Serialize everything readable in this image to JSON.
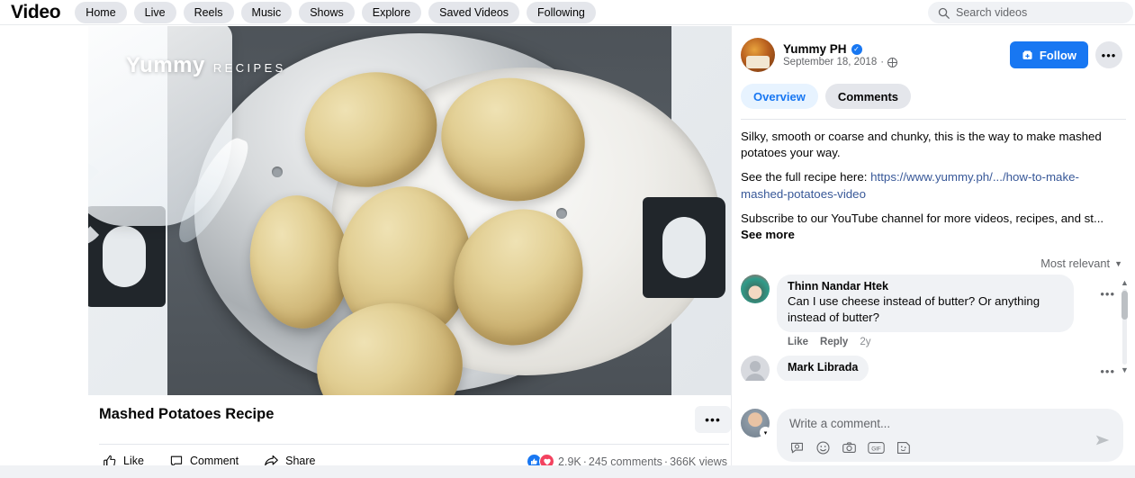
{
  "topbar": {
    "brand": "Video",
    "nav_items": [
      "Home",
      "Live",
      "Reels",
      "Music",
      "Shows",
      "Explore",
      "Saved Videos",
      "Following"
    ],
    "search_placeholder": "Search videos",
    "search_icon": "search-icon"
  },
  "video": {
    "watermark_main": "Yummy",
    "watermark_sub": "RECIPES",
    "title": "Mashed Potatoes Recipe",
    "more_label": "•••",
    "actions": [
      {
        "label": "Like",
        "icon": "thumbs-up-icon"
      },
      {
        "label": "Comment",
        "icon": "comment-bubble-icon"
      },
      {
        "label": "Share",
        "icon": "share-arrow-icon"
      }
    ],
    "reaction_like_icon": "like-reaction-icon",
    "reaction_love_icon": "love-reaction-icon",
    "reaction_count": "2.9K",
    "sep1": "·",
    "comment_count": "245 comments",
    "sep2": "·",
    "view_count": "366K views"
  },
  "side": {
    "poster_name": "Yummy PH",
    "verified_glyph": "✓",
    "posted_date": "September 18, 2018",
    "date_dot": "·",
    "privacy_icon": "globe-icon",
    "follow_label": "Follow",
    "follow_icon": "follow-plus-icon",
    "more_label": "•••",
    "tabs": [
      {
        "label": "Overview",
        "active": true
      },
      {
        "label": "Comments",
        "active": false
      }
    ],
    "description": {
      "para1": "Silky, smooth or coarse and chunky, this is the way to make mashed potatoes your way.",
      "para2_prefix": "See the full recipe here: ",
      "para2_link": "https://www.yummy.ph/.../how-to-make-mashed-potatoes-video",
      "para3": "Subscribe to our YouTube channel for more videos, recipes, and st...",
      "see_more": "See more"
    },
    "sort_label": "Most relevant",
    "sort_caret": "▼",
    "comments": [
      {
        "name": "Thinn Nandar Htek",
        "text": "Can I use cheese instead of butter? Or anything instead of butter?",
        "like": "Like",
        "reply": "Reply",
        "time": "2y",
        "more": "•••"
      },
      {
        "name": "Mark Librada",
        "text": "",
        "more": "•••"
      }
    ],
    "scroll_up": "▲",
    "scroll_down": "▼",
    "composer": {
      "placeholder": "Write a comment...",
      "icons": [
        "comment-sticker-icon",
        "emoji-icon",
        "camera-icon",
        "gif-icon",
        "avatar-sticker-icon"
      ],
      "send_icon": "send-icon",
      "avatar_caret": "▾"
    }
  },
  "colors": {
    "brand_blue": "#1877f2",
    "pill_gray": "#e4e6eb",
    "page_bg": "#ffffff",
    "link_blue": "#385898",
    "tab_active_bg": "#e7f3ff",
    "love_red": "#f3425f"
  }
}
